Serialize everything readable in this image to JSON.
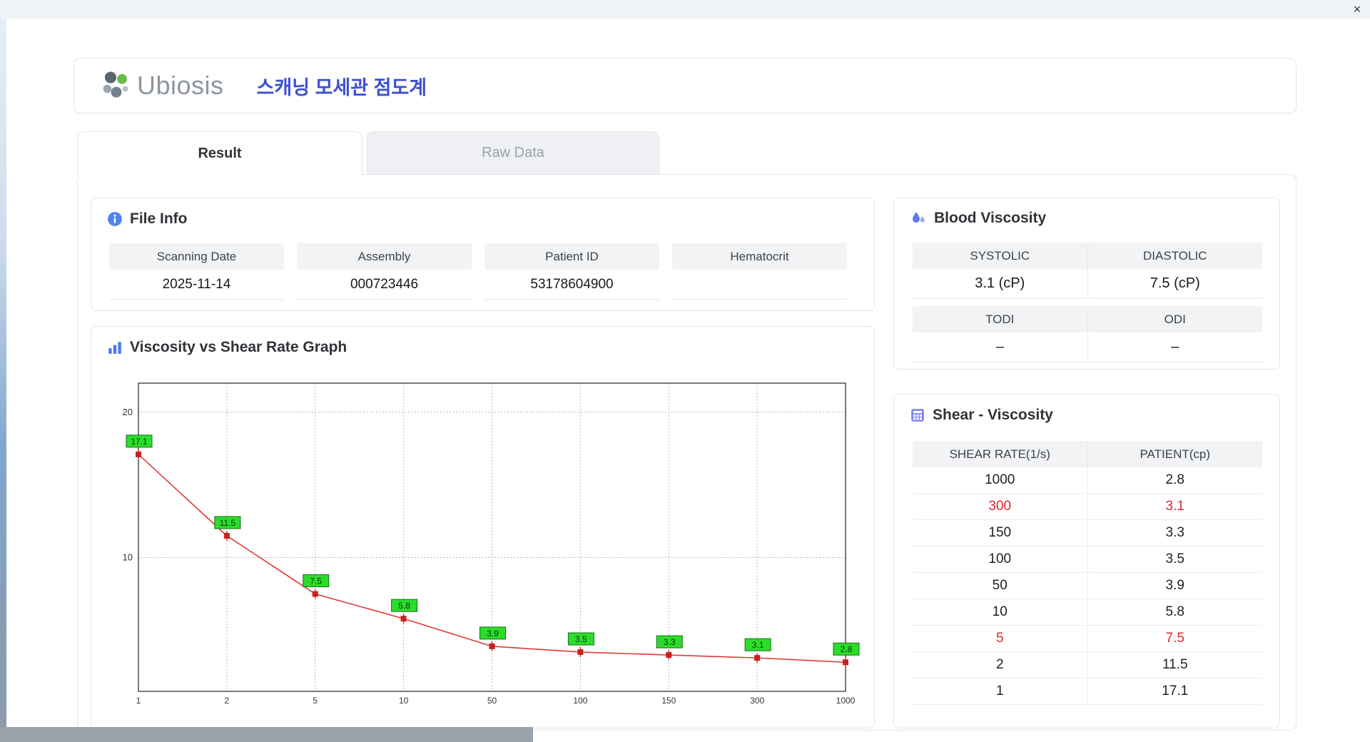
{
  "window": {
    "close_label": "×"
  },
  "header": {
    "logo_text": "Ubiosis",
    "title": "스캐닝 모세관 점도계"
  },
  "tabs": [
    {
      "label": "Result",
      "active": true
    },
    {
      "label": "Raw Data",
      "active": false
    }
  ],
  "file_info": {
    "title": "File Info",
    "fields": [
      {
        "label": "Scanning Date",
        "value": "2025-11-14"
      },
      {
        "label": "Assembly",
        "value": "000723446"
      },
      {
        "label": "Patient ID",
        "value": "53178604900"
      },
      {
        "label": "Hematocrit",
        "value": ""
      }
    ]
  },
  "graph": {
    "title": "Viscosity vs Shear Rate Graph"
  },
  "blood_viscosity": {
    "title": "Blood Viscosity",
    "rows": [
      {
        "h1": "SYSTOLIC",
        "h2": "DIASTOLIC",
        "v1": "3.1 (cP)",
        "v2": "7.5 (cP)"
      },
      {
        "h1": "TODI",
        "h2": "ODI",
        "v1": "–",
        "v2": "–"
      }
    ]
  },
  "shear_viscosity": {
    "title": "Shear - Viscosity",
    "columns": [
      "SHEAR RATE(1/s)",
      "PATIENT(cp)"
    ],
    "rows": [
      {
        "shear": "1000",
        "patient": "2.8",
        "highlight": false
      },
      {
        "shear": "300",
        "patient": "3.1",
        "highlight": true
      },
      {
        "shear": "150",
        "patient": "3.3",
        "highlight": false
      },
      {
        "shear": "100",
        "patient": "3.5",
        "highlight": false
      },
      {
        "shear": "50",
        "patient": "3.9",
        "highlight": false
      },
      {
        "shear": "10",
        "patient": "5.8",
        "highlight": false
      },
      {
        "shear": "5",
        "patient": "7.5",
        "highlight": true
      },
      {
        "shear": "2",
        "patient": "11.5",
        "highlight": false
      },
      {
        "shear": "1",
        "patient": "17.1",
        "highlight": false
      }
    ]
  },
  "chart_data": {
    "type": "line",
    "title": "Viscosity vs Shear Rate Graph",
    "categories": [
      1,
      2,
      5,
      10,
      50,
      100,
      150,
      300,
      1000
    ],
    "values": [
      17.1,
      11.5,
      7.5,
      5.8,
      3.9,
      3.5,
      3.3,
      3.1,
      2.8
    ],
    "xlabel": "",
    "ylabel": "",
    "x_axis": "category",
    "ylim": [
      0.8,
      22
    ],
    "yticks": [
      10,
      20
    ],
    "grid": true,
    "legend": false,
    "line_color": "#e03a3a",
    "marker_color": "#c9201f",
    "label_bg": "#2bdd2b",
    "label_border": "#1a6b1a"
  }
}
